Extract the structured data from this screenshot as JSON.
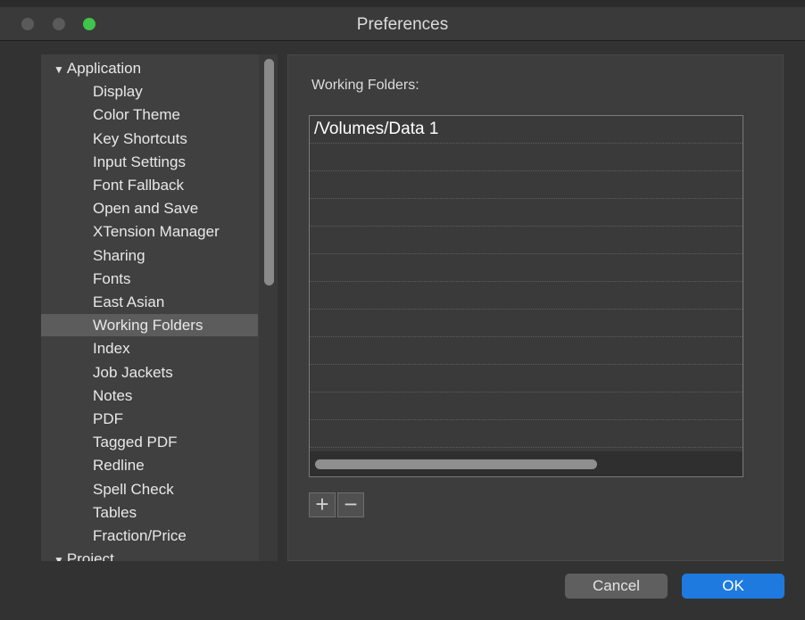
{
  "window": {
    "title": "Preferences"
  },
  "sidebar": {
    "items": [
      {
        "label": "Application",
        "parent": true,
        "selected": false
      },
      {
        "label": "Display",
        "parent": false,
        "selected": false
      },
      {
        "label": "Color Theme",
        "parent": false,
        "selected": false
      },
      {
        "label": "Key Shortcuts",
        "parent": false,
        "selected": false
      },
      {
        "label": "Input Settings",
        "parent": false,
        "selected": false
      },
      {
        "label": "Font Fallback",
        "parent": false,
        "selected": false
      },
      {
        "label": "Open and Save",
        "parent": false,
        "selected": false
      },
      {
        "label": "XTension Manager",
        "parent": false,
        "selected": false
      },
      {
        "label": "Sharing",
        "parent": false,
        "selected": false
      },
      {
        "label": "Fonts",
        "parent": false,
        "selected": false
      },
      {
        "label": "East Asian",
        "parent": false,
        "selected": false
      },
      {
        "label": "Working Folders",
        "parent": false,
        "selected": true
      },
      {
        "label": "Index",
        "parent": false,
        "selected": false
      },
      {
        "label": "Job Jackets",
        "parent": false,
        "selected": false
      },
      {
        "label": "Notes",
        "parent": false,
        "selected": false
      },
      {
        "label": "PDF",
        "parent": false,
        "selected": false
      },
      {
        "label": "Tagged PDF",
        "parent": false,
        "selected": false
      },
      {
        "label": "Redline",
        "parent": false,
        "selected": false
      },
      {
        "label": "Spell Check",
        "parent": false,
        "selected": false
      },
      {
        "label": "Tables",
        "parent": false,
        "selected": false
      },
      {
        "label": "Fraction/Price",
        "parent": false,
        "selected": false
      },
      {
        "label": "Project",
        "parent": true,
        "selected": false
      }
    ]
  },
  "main": {
    "section_label": "Working Folders:",
    "folders": [
      "/Volumes/Data 1"
    ],
    "add_symbol": "+",
    "remove_symbol": "−"
  },
  "footer": {
    "cancel_label": "Cancel",
    "ok_label": "OK"
  },
  "colors": {
    "accent": "#1f7ae0",
    "zoom_button": "#3fc54a",
    "selection": "#5c5c5c"
  }
}
